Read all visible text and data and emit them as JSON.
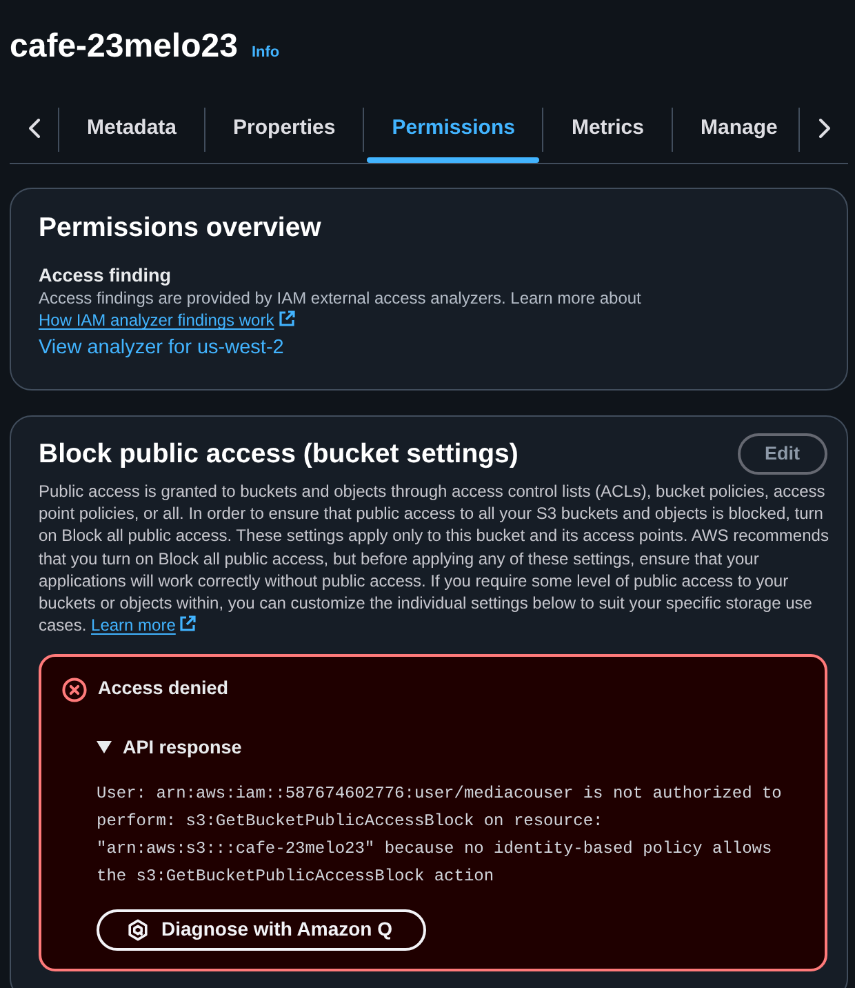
{
  "page_header": {
    "title": "cafe-23melo23",
    "info_link": "Info"
  },
  "tabs": [
    {
      "label": "Metadata",
      "selected": false
    },
    {
      "label": "Properties",
      "selected": false
    },
    {
      "label": "Permissions",
      "selected": true
    },
    {
      "label": "Metrics",
      "selected": false
    },
    {
      "label": "Manage",
      "selected": false
    }
  ],
  "permissions_overview": {
    "title": "Permissions overview",
    "access_finding": {
      "label": "Access finding",
      "text": "Access findings are provided by IAM external access analyzers. Learn more about",
      "link": "How IAM analyzer findings work"
    },
    "analyzer_link": "View analyzer for us-west-2"
  },
  "block_public_access": {
    "title": "Block public access (bucket settings)",
    "edit_button": {
      "label": "Edit",
      "disabled": true
    },
    "description": "Public access is granted to buckets and objects through access control lists (ACLs), bucket policies, access point policies, or all. In order to ensure that public access to all your S3 buckets and objects is blocked, turn on Block all public access. These settings apply only to this bucket and its access points. AWS recommends that you turn on Block all public access, but before applying any of these settings, ensure that your applications will work correctly without public access. If you require some level of public access to your buckets or objects within, you can customize the individual settings below to suit your specific storage use cases.",
    "learn_more_link": "Learn more",
    "alert": {
      "kind": "error",
      "title": "Access denied",
      "details": {
        "label": "API response",
        "expanded": true,
        "message": "User: arn:aws:iam::587674602776:user/mediacouser is not authorized to perform: s3:GetBucketPublicAccessBlock on resource: \"arn:aws:s3:::cafe-23melo23\" because no identity-based policy allows the s3:GetBucketPublicAccessBlock action"
      },
      "action_button": "Diagnose with Amazon Q"
    }
  }
}
